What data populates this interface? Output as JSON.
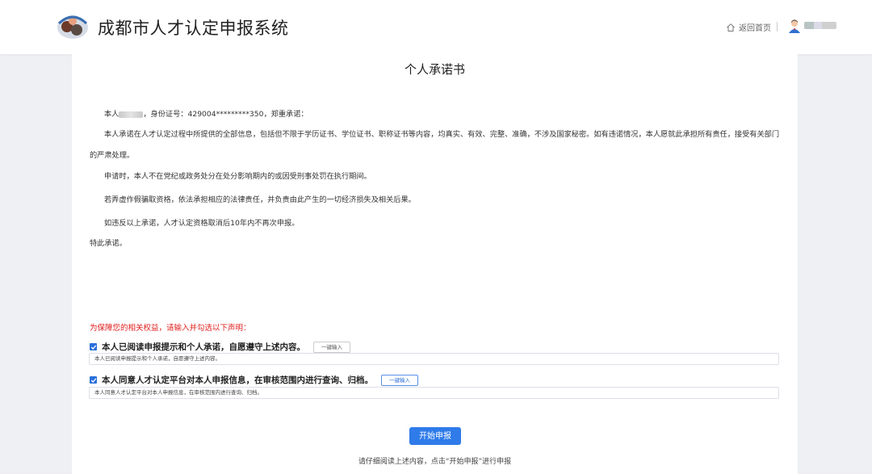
{
  "header": {
    "title": "成都市人才认定申报系统",
    "home_label": "返回首页",
    "icons": [
      "logo",
      "home-icon",
      "user-avatar-icon"
    ]
  },
  "document": {
    "title": "个人承诺书",
    "intro_prefix": "本人",
    "intro_suffix": "，身份证号：429004*********350，郑重承诺：",
    "p1": "本人承诺在人才认定过程中所提供的全部信息，包括但不限于学历证书、学位证书、职称证书等内容，均真实、有效、完整、准确，不涉及国家秘密。如有违诺情况，本人愿就此承担所有责任，接受有关部门的严肃处理。",
    "p2": "申请时，本人不在党纪或政务处分在处分影响期内的或因受刑事处罚在执行期间。",
    "p3": "若弄虚作假骗取资格，依法承担相应的法律责任，并负责由此产生的一切经济损失及相关后果。",
    "p4": "如违反以上承诺，人才认定资格取消后10年内不再次申报。",
    "closing": "特此承诺。"
  },
  "declarations": {
    "notice": "为保障您的相关权益，请输入并勾选以下声明：",
    "item1_label": "本人已阅读申报提示和个人承诺，自愿遵守上述内容。",
    "item1_button": "一键输入",
    "item1_value": "本人已阅读申报提示和个人承诺，自愿遵守上述内容。",
    "item2_label": "本人同意人才认定平台对本人申报信息，在审核范围内进行查询、归档。",
    "item2_button": "一键输入",
    "item2_value": "本人同意人才认定平台对本人申报信息，在审核范围内进行查询、归档。"
  },
  "actions": {
    "start_label": "开始申报",
    "hint": "请仔细阅读上述内容，点击“开始申报”进行申报"
  },
  "colors": {
    "accent": "#2f7bea",
    "warning": "#e02020",
    "page_bg": "#eef0f3"
  }
}
